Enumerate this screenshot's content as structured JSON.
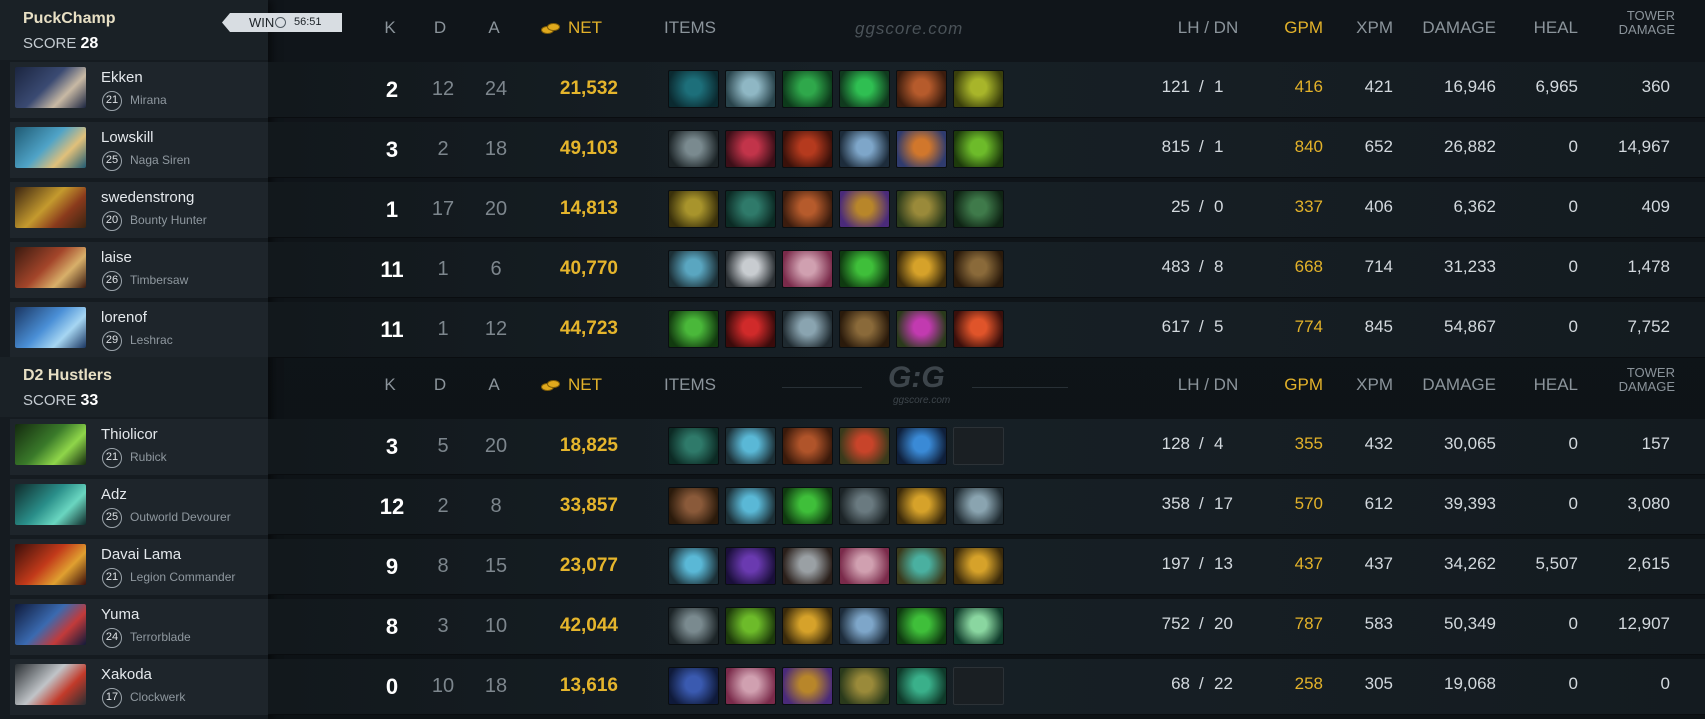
{
  "teams": [
    {
      "name": "PuckChamp",
      "score_label": "SCORE",
      "score": "28",
      "result": "WIN",
      "time": "56:51",
      "headers": {
        "k": "K",
        "d": "D",
        "a": "A",
        "net": "NET",
        "items": "ITEMS",
        "lh_dn": "LH  /  DN",
        "gpm": "GPM",
        "xpm": "XPM",
        "damage": "DAMAGE",
        "heal": "HEAL",
        "tower1": "TOWER",
        "tower2": "DAMAGE"
      },
      "watermark": "ggscore.com",
      "players": [
        {
          "name": "Ekken",
          "level": "21",
          "hero": "Mirana",
          "portrait": [
            "#3a4a72",
            "#c8b9a4",
            "#1b2540"
          ],
          "k": "2",
          "d": "12",
          "a": "24",
          "net": "21,532",
          "lh": "121",
          "dn": "1",
          "gpm": "416",
          "xpm": "421",
          "damage": "16,946",
          "heal": "6,965",
          "tower": "360",
          "items": [
            [
              "#1d6f7a",
              "#0b2a30"
            ],
            [
              "#8fb7c4",
              "#29434b"
            ],
            [
              "#2fa84b",
              "#0d3a1b"
            ],
            [
              "#2fbf52",
              "#103a1e"
            ],
            [
              "#b65b2c",
              "#3b1c0e"
            ],
            [
              "#a8b52a",
              "#3a3f0b"
            ]
          ]
        },
        {
          "name": "Lowskill",
          "level": "25",
          "hero": "Naga Siren",
          "portrait": [
            "#4fa3c7",
            "#e0c07a",
            "#1f5a73"
          ],
          "k": "3",
          "d": "2",
          "a": "18",
          "net": "49,103",
          "lh": "815",
          "dn": "1",
          "gpm": "840",
          "xpm": "652",
          "damage": "26,882",
          "heal": "0",
          "tower": "14,967",
          "items": [
            [
              "#7a8a8f",
              "#1c2427"
            ],
            [
              "#c2344a",
              "#3c0f18"
            ],
            [
              "#b53a1e",
              "#3a110a"
            ],
            [
              "#7ea6c9",
              "#1d2c3b"
            ],
            [
              "#d1772c",
              "#2f3b6e"
            ],
            [
              "#6dbb2a",
              "#1d3a0b"
            ]
          ]
        },
        {
          "name": "swedenstrong",
          "level": "20",
          "hero": "Bounty Hunter",
          "portrait": [
            "#c49a2e",
            "#8a3a1c",
            "#3a2412"
          ],
          "k": "1",
          "d": "17",
          "a": "20",
          "net": "14,813",
          "lh": "25",
          "dn": "0",
          "gpm": "337",
          "xpm": "406",
          "damage": "6,362",
          "heal": "0",
          "tower": "409",
          "items": [
            [
              "#a8942c",
              "#3a310b"
            ],
            [
              "#2f7a6a",
              "#0c2a24"
            ],
            [
              "#b65b2c",
              "#3b1c0e"
            ],
            [
              "#b8862a",
              "#4a2a7a"
            ],
            [
              "#9a8a3a",
              "#2a3a1b"
            ],
            [
              "#3f7a4a",
              "#0f2414"
            ]
          ]
        },
        {
          "name": "laise",
          "level": "26",
          "hero": "Timbersaw",
          "portrait": [
            "#a3452a",
            "#d8b06a",
            "#3a1a10"
          ],
          "k": "11",
          "d": "1",
          "a": "6",
          "net": "40,770",
          "lh": "483",
          "dn": "8",
          "gpm": "668",
          "xpm": "714",
          "damage": "31,233",
          "heal": "0",
          "tower": "1,478",
          "items": [
            [
              "#5aa6c0",
              "#1c2f36"
            ],
            [
              "#c8ccd0",
              "#2a2f33"
            ],
            [
              "#d0a0b0",
              "#7a2a4a"
            ],
            [
              "#3fbf3a",
              "#0f3a10"
            ],
            [
              "#d6a22a",
              "#3a2a0b"
            ],
            [
              "#8a6a3a",
              "#2a1a0b"
            ]
          ]
        },
        {
          "name": "lorenof",
          "level": "29",
          "hero": "Leshrac",
          "portrait": [
            "#4a8fd6",
            "#a6d6f2",
            "#1a3560"
          ],
          "k": "11",
          "d": "1",
          "a": "12",
          "net": "44,723",
          "lh": "617",
          "dn": "5",
          "gpm": "774",
          "xpm": "845",
          "damage": "54,867",
          "heal": "0",
          "tower": "7,752",
          "items": [
            [
              "#4ab83a",
              "#123a0f"
            ],
            [
              "#d02a2a",
              "#3a0b0b"
            ],
            [
              "#8aa4b0",
              "#1f2a30"
            ],
            [
              "#8a6a3a",
              "#2a1a0b"
            ],
            [
              "#c23ab0",
              "#2a3a1b"
            ],
            [
              "#e0542a",
              "#3a0f0b"
            ]
          ]
        }
      ]
    },
    {
      "name": "D2 Hustlers",
      "score_label": "SCORE",
      "score": "33",
      "headers": {
        "k": "K",
        "d": "D",
        "a": "A",
        "net": "NET",
        "items": "ITEMS",
        "lh_dn": "LH  /  DN",
        "gpm": "GPM",
        "xpm": "XPM",
        "damage": "DAMAGE",
        "heal": "HEAL",
        "tower1": "TOWER",
        "tower2": "DAMAGE"
      },
      "watermark_logo": "G:G",
      "watermark": "ggscore.com",
      "players": [
        {
          "name": "Thiolicor",
          "level": "21",
          "hero": "Rubick",
          "portrait": [
            "#3a7a2a",
            "#8fd64a",
            "#142a0f"
          ],
          "k": "3",
          "d": "5",
          "a": "20",
          "net": "18,825",
          "lh": "128",
          "dn": "4",
          "gpm": "355",
          "xpm": "432",
          "damage": "30,065",
          "heal": "0",
          "tower": "157",
          "items": [
            [
              "#2f7a6a",
              "#0c2a24"
            ],
            [
              "#5ab8d6",
              "#1c2f36"
            ],
            [
              "#b0542a",
              "#3a1a0b"
            ],
            [
              "#c8442a",
              "#3a3a1b"
            ],
            [
              "#3a8ad6",
              "#0f1f3a"
            ],
            null
          ]
        },
        {
          "name": "Adz",
          "level": "25",
          "hero": "Outworld Devourer",
          "portrait": [
            "#2a8f8a",
            "#6ad6c0",
            "#0f2a2a"
          ],
          "k": "12",
          "d": "2",
          "a": "8",
          "net": "33,857",
          "lh": "358",
          "dn": "17",
          "gpm": "570",
          "xpm": "612",
          "damage": "39,393",
          "heal": "0",
          "tower": "3,080",
          "items": [
            [
              "#8a5a3a",
              "#2a1a0b"
            ],
            [
              "#5ab8d6",
              "#1c2f36"
            ],
            [
              "#3fbf3a",
              "#0f3a10"
            ],
            [
              "#6a7a80",
              "#1c2427"
            ],
            [
              "#d6a22a",
              "#3a2a0b"
            ],
            [
              "#8aa4b0",
              "#1f2a30"
            ]
          ]
        },
        {
          "name": "Davai Lama",
          "level": "21",
          "hero": "Legion Commander",
          "portrait": [
            "#c23a1a",
            "#e0a030",
            "#3a0f0b"
          ],
          "k": "9",
          "d": "8",
          "a": "15",
          "net": "23,077",
          "lh": "197",
          "dn": "13",
          "gpm": "437",
          "xpm": "437",
          "damage": "34,262",
          "heal": "5,507",
          "tower": "2,615",
          "items": [
            [
              "#5ab8d6",
              "#1c2f36"
            ],
            [
              "#6a3ab0",
              "#1a0f3a"
            ],
            [
              "#9aa0a4",
              "#2a1f1a"
            ],
            [
              "#d0a0b0",
              "#7a2a4a"
            ],
            [
              "#4ab0a0",
              "#3a3a1b"
            ],
            [
              "#d6a22a",
              "#3a2a0b"
            ]
          ]
        },
        {
          "name": "Yuma",
          "level": "24",
          "hero": "Terrorblade",
          "portrait": [
            "#3a6ab0",
            "#c23a3a",
            "#0f1a3a"
          ],
          "k": "8",
          "d": "3",
          "a": "10",
          "net": "42,044",
          "lh": "752",
          "dn": "20",
          "gpm": "787",
          "xpm": "583",
          "damage": "50,349",
          "heal": "0",
          "tower": "12,907",
          "items": [
            [
              "#7a8a8f",
              "#1c2427"
            ],
            [
              "#6dbb2a",
              "#1d3a0b"
            ],
            [
              "#d6a22a",
              "#3a2a0b"
            ],
            [
              "#7ea6c9",
              "#1d2c3b"
            ],
            [
              "#3fbf3a",
              "#0f3a10"
            ],
            [
              "#8ad6a0",
              "#0f3a2a"
            ]
          ]
        },
        {
          "name": "Xakoda",
          "level": "17",
          "hero": "Clockwerk",
          "portrait": [
            "#c0c4c8",
            "#c23a2a",
            "#2a2f33"
          ],
          "k": "0",
          "d": "10",
          "a": "18",
          "net": "13,616",
          "lh": "68",
          "dn": "22",
          "gpm": "258",
          "xpm": "305",
          "damage": "19,068",
          "heal": "0",
          "tower": "0",
          "items": [
            [
              "#3a5ab0",
              "#0f1a3a"
            ],
            [
              "#d0a0b0",
              "#7a2a4a"
            ],
            [
              "#b8862a",
              "#4a2a7a"
            ],
            [
              "#9a8a3a",
              "#2a3a1b"
            ],
            [
              "#3ab08a",
              "#0f3a2a"
            ],
            null
          ]
        }
      ]
    }
  ]
}
